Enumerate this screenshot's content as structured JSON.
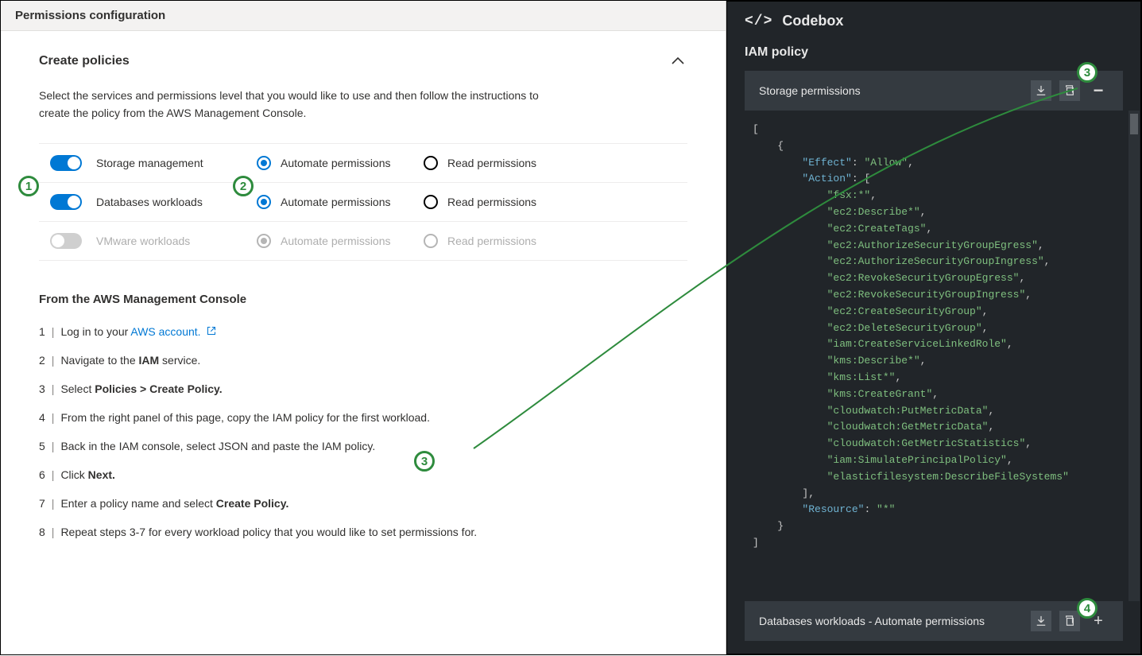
{
  "header": {
    "title": "Permissions configuration"
  },
  "createPolicies": {
    "title": "Create policies",
    "desc": "Select the services and permissions level that you would like to use and then follow the instructions to create the policy from the AWS Management Console.",
    "rows": [
      {
        "name": "Storage management",
        "toggle": "on",
        "automate": "Automate permissions",
        "read": "Read permissions",
        "selected": "automate",
        "enabled": true
      },
      {
        "name": "Databases workloads",
        "toggle": "on",
        "automate": "Automate permissions",
        "read": "Read permissions",
        "selected": "automate",
        "enabled": true
      },
      {
        "name": "VMware workloads",
        "toggle": "off",
        "automate": "Automate permissions",
        "read": "Read permissions",
        "selected": "automate",
        "enabled": false
      }
    ]
  },
  "instructions": {
    "heading": "From the AWS Management Console",
    "steps": [
      "Log in to your <a href='#'>AWS account.</a> <svg class='ext-icon' viewBox='0 0 16 16'><path fill='none' stroke='#0078d4' stroke-width='1.4' d='M6 2H2v12h12v-4M9 2h5v5M14 2 7 9'/></svg>",
      "Navigate to the <strong>IAM</strong> service.",
      "Select <strong>Policies &gt; Create Policy.</strong>",
      "From the right panel of this page, copy the IAM policy for the first workload.",
      "Back in the IAM console, select JSON and paste the IAM policy.",
      "Click <strong>Next.</strong>",
      "Enter a policy name and select <strong>Create Policy.</strong>",
      "Repeat steps 3-7 for every workload policy that you would like to set permissions for."
    ]
  },
  "codebox": {
    "title": "Codebox",
    "subtitle": "IAM policy",
    "section": "Storage permissions",
    "bottom": "Databases workloads - Automate permissions",
    "code_lines": [
      {
        "indent": 0,
        "tokens": [
          {
            "t": "[",
            "c": "punc"
          }
        ]
      },
      {
        "indent": 1,
        "tokens": [
          {
            "t": "{",
            "c": "punc"
          }
        ]
      },
      {
        "indent": 2,
        "tokens": [
          {
            "t": "\"Effect\"",
            "c": "key"
          },
          {
            "t": ": ",
            "c": "punc"
          },
          {
            "t": "\"Allow\"",
            "c": "str"
          },
          {
            "t": ",",
            "c": "punc"
          }
        ]
      },
      {
        "indent": 2,
        "tokens": [
          {
            "t": "\"Action\"",
            "c": "key"
          },
          {
            "t": ": [",
            "c": "punc"
          }
        ]
      },
      {
        "indent": 3,
        "tokens": [
          {
            "t": "\"fsx:*\"",
            "c": "str"
          },
          {
            "t": ",",
            "c": "punc"
          }
        ]
      },
      {
        "indent": 3,
        "tokens": [
          {
            "t": "\"ec2:Describe*\"",
            "c": "str"
          },
          {
            "t": ",",
            "c": "punc"
          }
        ]
      },
      {
        "indent": 3,
        "tokens": [
          {
            "t": "\"ec2:CreateTags\"",
            "c": "str"
          },
          {
            "t": ",",
            "c": "punc"
          }
        ]
      },
      {
        "indent": 3,
        "tokens": [
          {
            "t": "\"ec2:AuthorizeSecurityGroupEgress\"",
            "c": "str"
          },
          {
            "t": ",",
            "c": "punc"
          }
        ]
      },
      {
        "indent": 3,
        "tokens": [
          {
            "t": "\"ec2:AuthorizeSecurityGroupIngress\"",
            "c": "str"
          },
          {
            "t": ",",
            "c": "punc"
          }
        ]
      },
      {
        "indent": 3,
        "tokens": [
          {
            "t": "\"ec2:RevokeSecurityGroupEgress\"",
            "c": "str"
          },
          {
            "t": ",",
            "c": "punc"
          }
        ]
      },
      {
        "indent": 3,
        "tokens": [
          {
            "t": "\"ec2:RevokeSecurityGroupIngress\"",
            "c": "str"
          },
          {
            "t": ",",
            "c": "punc"
          }
        ]
      },
      {
        "indent": 3,
        "tokens": [
          {
            "t": "\"ec2:CreateSecurityGroup\"",
            "c": "str"
          },
          {
            "t": ",",
            "c": "punc"
          }
        ]
      },
      {
        "indent": 3,
        "tokens": [
          {
            "t": "\"ec2:DeleteSecurityGroup\"",
            "c": "str"
          },
          {
            "t": ",",
            "c": "punc"
          }
        ]
      },
      {
        "indent": 3,
        "tokens": [
          {
            "t": "\"iam:CreateServiceLinkedRole\"",
            "c": "str"
          },
          {
            "t": ",",
            "c": "punc"
          }
        ]
      },
      {
        "indent": 3,
        "tokens": [
          {
            "t": "\"kms:Describe*\"",
            "c": "str"
          },
          {
            "t": ",",
            "c": "punc"
          }
        ]
      },
      {
        "indent": 3,
        "tokens": [
          {
            "t": "\"kms:List*\"",
            "c": "str"
          },
          {
            "t": ",",
            "c": "punc"
          }
        ]
      },
      {
        "indent": 3,
        "tokens": [
          {
            "t": "\"kms:CreateGrant\"",
            "c": "str"
          },
          {
            "t": ",",
            "c": "punc"
          }
        ]
      },
      {
        "indent": 3,
        "tokens": [
          {
            "t": "\"cloudwatch:PutMetricData\"",
            "c": "str"
          },
          {
            "t": ",",
            "c": "punc"
          }
        ]
      },
      {
        "indent": 3,
        "tokens": [
          {
            "t": "\"cloudwatch:GetMetricData\"",
            "c": "str"
          },
          {
            "t": ",",
            "c": "punc"
          }
        ]
      },
      {
        "indent": 3,
        "tokens": [
          {
            "t": "\"cloudwatch:GetMetricStatistics\"",
            "c": "str"
          },
          {
            "t": ",",
            "c": "punc"
          }
        ]
      },
      {
        "indent": 3,
        "tokens": [
          {
            "t": "\"iam:SimulatePrincipalPolicy\"",
            "c": "str"
          },
          {
            "t": ",",
            "c": "punc"
          }
        ]
      },
      {
        "indent": 3,
        "tokens": [
          {
            "t": "\"elasticfilesystem:DescribeFileSystems\"",
            "c": "str"
          }
        ]
      },
      {
        "indent": 2,
        "tokens": [
          {
            "t": "],",
            "c": "punc"
          }
        ]
      },
      {
        "indent": 2,
        "tokens": [
          {
            "t": "\"Resource\"",
            "c": "key"
          },
          {
            "t": ": ",
            "c": "punc"
          },
          {
            "t": "\"*\"",
            "c": "str"
          }
        ]
      },
      {
        "indent": 1,
        "tokens": [
          {
            "t": "}",
            "c": "punc"
          }
        ]
      },
      {
        "indent": 0,
        "tokens": [
          {
            "t": "]",
            "c": "punc"
          }
        ]
      }
    ]
  },
  "callouts": {
    "b1": "1",
    "b2": "2",
    "b3": "3",
    "b3b": "3",
    "b4": "4"
  }
}
